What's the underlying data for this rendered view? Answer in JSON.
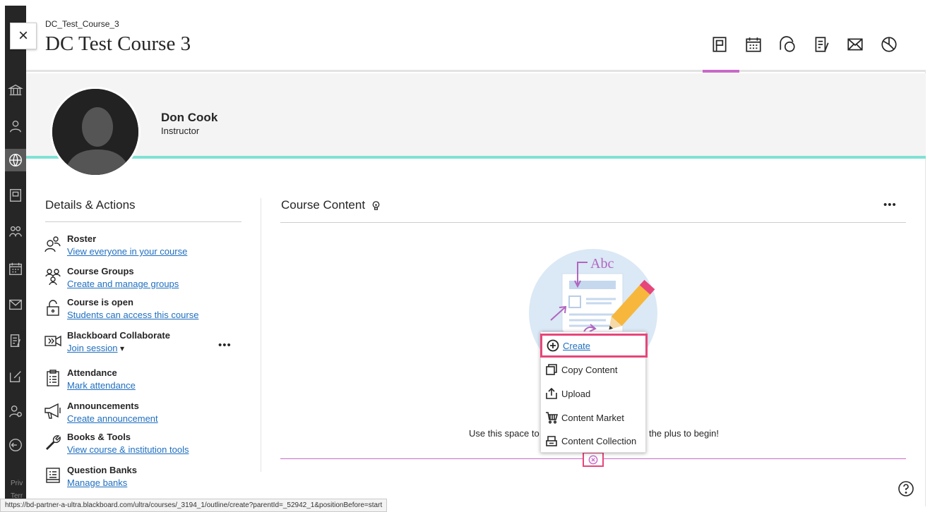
{
  "header": {
    "breadcrumb": "DC_Test_Course_3",
    "title": "DC Test Course 3",
    "close_label": "×"
  },
  "tabs": [
    {
      "name": "content-icon"
    },
    {
      "name": "calendar-icon"
    },
    {
      "name": "discussions-icon"
    },
    {
      "name": "gradebook-icon"
    },
    {
      "name": "messages-icon"
    },
    {
      "name": "analytics-icon"
    }
  ],
  "instructor": {
    "name": "Don Cook",
    "role": "Instructor"
  },
  "details": {
    "title": "Details & Actions",
    "items": [
      {
        "label": "Roster",
        "link": "View everyone in your course",
        "icon": "roster-icon"
      },
      {
        "label": "Course Groups",
        "link": "Create and manage groups",
        "icon": "groups-icon"
      },
      {
        "label": "Course is open",
        "link": "Students can access this course",
        "icon": "unlock-icon"
      },
      {
        "label": "Blackboard Collaborate",
        "link": "Join session",
        "icon": "collaborate-icon"
      },
      {
        "label": "Attendance",
        "link": "Mark attendance",
        "icon": "attendance-icon"
      },
      {
        "label": "Announcements",
        "link": "Create announcement",
        "icon": "megaphone-icon"
      },
      {
        "label": "Books & Tools",
        "link": "View course & institution tools",
        "icon": "wrench-icon"
      },
      {
        "label": "Question Banks",
        "link": "Manage banks",
        "icon": "question-bank-icon"
      }
    ],
    "more": "•••",
    "caret": "▾"
  },
  "content": {
    "title": "Course Content",
    "more": "•••",
    "empty_left": "Use this space to",
    "empty_right": "the plus to begin!",
    "illustration_text": "Abc"
  },
  "menu": {
    "items": [
      "Create",
      "Copy Content",
      "Upload",
      "Content Market",
      "Content Collection"
    ]
  },
  "global_nav": {
    "footer_1": "Priv",
    "footer_2": "Terr"
  },
  "statusbar": "https://bd-partner-a-ultra.blackboard.com/ultra/courses/_3194_1/outline/create?parentId=_52942_1&positionBefore=start",
  "colors": {
    "accent": "#c869c8",
    "highlight": "#e6467a",
    "link": "#1f6fbf",
    "teal": "#7fe2d4"
  }
}
